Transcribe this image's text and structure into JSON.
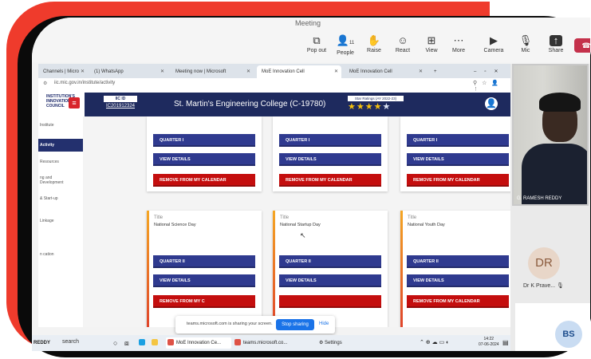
{
  "teams": {
    "meeting_title": "Meeting",
    "buttons": [
      {
        "label": "Pop out",
        "icon": "popout-icon"
      },
      {
        "label": "People",
        "icon": "people-icon",
        "count": "11"
      },
      {
        "label": "Raise",
        "icon": "hand-icon"
      },
      {
        "label": "React",
        "icon": "smile-icon"
      },
      {
        "label": "View",
        "icon": "grid-icon"
      },
      {
        "label": "More",
        "icon": "more-icon"
      },
      {
        "label": "Camera",
        "icon": "camera-icon"
      },
      {
        "label": "Mic",
        "icon": "mic-off-icon"
      },
      {
        "label": "Share",
        "icon": "share-icon"
      }
    ]
  },
  "browser": {
    "tabs": [
      {
        "label": "Channels | Micro"
      },
      {
        "label": "(1) WhatsApp"
      },
      {
        "label": "Meeting now | Microsoft"
      },
      {
        "label": "MoE Innovation Cell"
      },
      {
        "label": "MoE Innovation Cell"
      }
    ],
    "url": "iic.mic.gov.in/institute/activity"
  },
  "site": {
    "logo_text": "INSTITUTION'S INNOVATION COUNCIL",
    "aic_label": "IIC ID",
    "aic_id": "IC201912324",
    "college": "St. Martin's Engineering College (C-19780)",
    "star_label": "Star Ratings (AY 2022-23)",
    "stars_filled": 4,
    "stars_total": 5
  },
  "sidebar": {
    "items": [
      "Institute",
      "Activity",
      "Resources",
      "ng and Development",
      "& Start-up",
      "Linkage",
      "n cation"
    ]
  },
  "cards": [
    {
      "title": "",
      "name": "",
      "quarter": "QUARTER I",
      "view": "VIEW DETAILS",
      "remove": "REMOVE FROM MY CALENDAR"
    },
    {
      "title": "",
      "name": "",
      "quarter": "QUARTER I",
      "view": "VIEW DETAILS",
      "remove": "REMOVE FROM MY CALENDAR"
    },
    {
      "title": "",
      "name": "",
      "quarter": "QUARTER I",
      "view": "VIEW DETAILS",
      "remove": "REMOVE FROM MY CALENDAR"
    },
    {
      "title": "Title",
      "name": "National Science Day",
      "quarter": "QUARTER II",
      "view": "VIEW DETAILS",
      "remove": "REMOVE FROM MY C"
    },
    {
      "title": "Title",
      "name": "National Startup Day",
      "quarter": "QUARTER II",
      "view": "VIEW DETAILS",
      "remove": ""
    },
    {
      "title": "Title",
      "name": "National Youth Day",
      "quarter": "QUARTER II",
      "view": "VIEW DETAILS",
      "remove": "REMOVE FROM MY CALENDAR"
    }
  ],
  "share_toast": {
    "message": "teams.microsoft.com is sharing your screen.",
    "stop": "Stop sharing",
    "hide": "Hide"
  },
  "taskbar": {
    "search": "search",
    "items": [
      "MoE Innovation Ce...",
      "teams.microsoft.co...",
      "Settings"
    ],
    "time": "14:22",
    "date": "07-06-2024",
    "left_label": "REDDY"
  },
  "participants": {
    "video_name": "G. RAMESH REDDY",
    "avatar_initials": "DR",
    "avatar_name": "Dr K Prave...",
    "avatar2_initials": "BS"
  },
  "colors": {
    "navy": "#1e2a5e",
    "button_blue": "#2f3a8f",
    "button_red": "#c40e0e",
    "frame_red": "#ef3b2c"
  }
}
